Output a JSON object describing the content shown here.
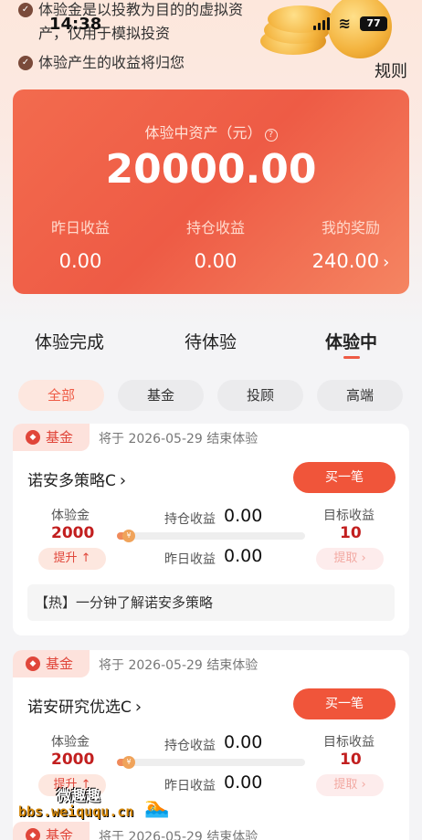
{
  "status_bar": {
    "time": "14:38",
    "battery": "77"
  },
  "notes": [
    "体验金是以投教为目的的虚拟资产，仅用于模拟投资",
    "体验产生的收益将归您"
  ],
  "header": {
    "rules_label": "规则"
  },
  "asset_card": {
    "title": "体验中资产（元）",
    "value": "20000.00",
    "stats": [
      {
        "label": "昨日收益",
        "value": "0.00"
      },
      {
        "label": "持仓收益",
        "value": "0.00"
      },
      {
        "label": "我的奖励",
        "value": "240.00"
      }
    ]
  },
  "tabs": [
    "体验完成",
    "待体验",
    "体验中"
  ],
  "active_tab": "体验中",
  "filters": [
    "全部",
    "基金",
    "投顾",
    "高端"
  ],
  "active_filter": "全部",
  "products": [
    {
      "tag": "基金",
      "end_text": "将于 2026-05-29 结束体验",
      "name": "诺安多策略C",
      "buy_label": "买一笔",
      "exp_label": "体验金",
      "exp_value": "2000",
      "boost_label": "提升",
      "hold_label": "持仓收益",
      "hold_value": "0.00",
      "yest_label": "昨日收益",
      "yest_value": "0.00",
      "target_label": "目标收益",
      "target_value": "10",
      "claim_label": "提取",
      "progress": 0.05,
      "hot_text": "【热】一分钟了解诺安多策略"
    },
    {
      "tag": "基金",
      "end_text": "将于 2026-05-29 结束体验",
      "name": "诺安研究优选C",
      "buy_label": "买一笔",
      "exp_label": "体验金",
      "exp_value": "2000",
      "boost_label": "提升",
      "hold_label": "持仓收益",
      "hold_value": "0.00",
      "yest_label": "昨日收益",
      "yest_value": "0.00",
      "target_label": "目标收益",
      "target_value": "10",
      "claim_label": "提取",
      "progress": 0.05
    },
    {
      "tag": "基金",
      "end_text": "将于 2026-05-29 结束体验"
    }
  ],
  "watermark": {
    "brand": "微趣趣",
    "url": "bbs.weiququ.cn"
  },
  "colors": {
    "accent": "#ee5b45",
    "card_gradient_start": "#f36b4e",
    "value_red": "#c21f1f"
  }
}
